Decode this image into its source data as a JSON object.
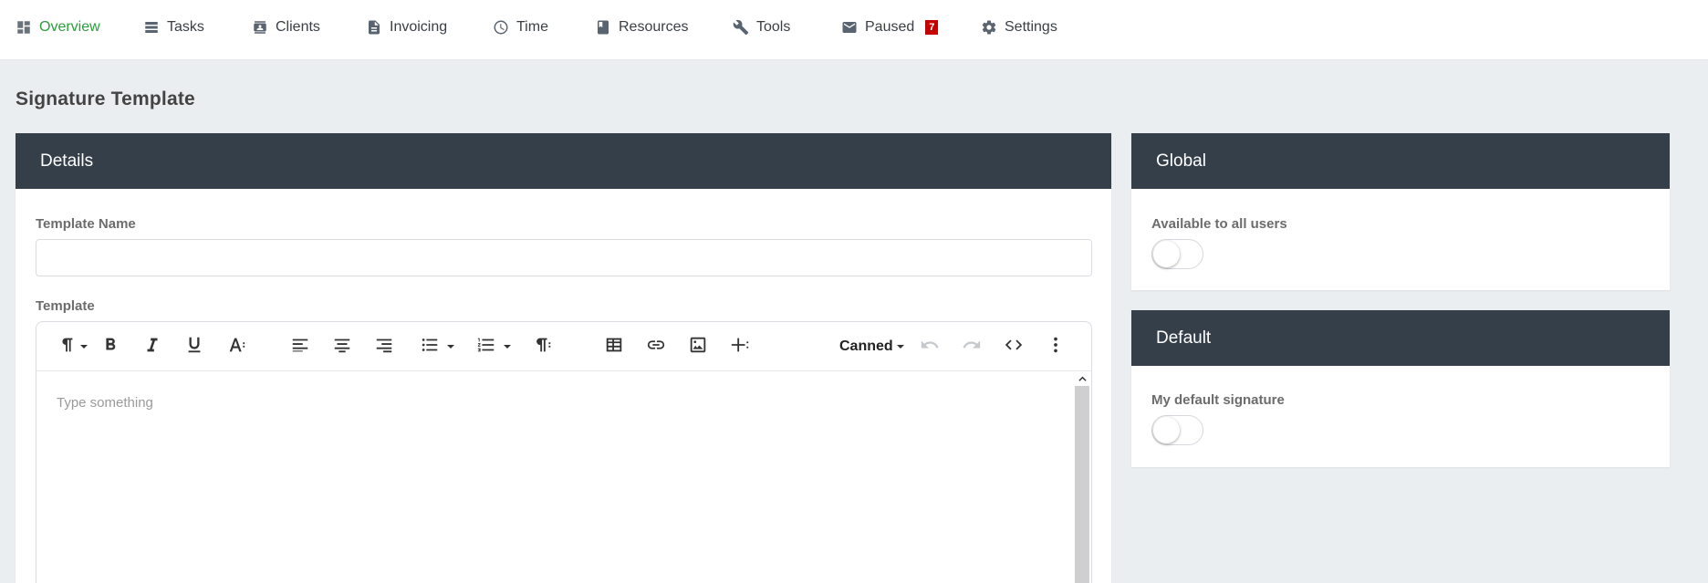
{
  "nav": {
    "items": [
      {
        "label": "Overview",
        "icon": "dashboard-icon",
        "active": true
      },
      {
        "label": "Tasks",
        "icon": "tasks-icon"
      },
      {
        "label": "Clients",
        "icon": "contact-card-icon"
      },
      {
        "label": "Invoicing",
        "icon": "document-icon"
      },
      {
        "label": "Time",
        "icon": "clock-icon"
      },
      {
        "label": "Resources",
        "icon": "book-icon"
      },
      {
        "label": "Tools",
        "icon": "wrench-icon"
      },
      {
        "label": "Paused",
        "icon": "mail-icon",
        "badge": "7"
      },
      {
        "label": "Settings",
        "icon": "gear-icon"
      }
    ],
    "active_color": "#2e9b3f",
    "badge_color": "#c40000"
  },
  "page": {
    "title": "Signature Template"
  },
  "details": {
    "header": "Details",
    "template_name_label": "Template Name",
    "template_name_value": "",
    "template_label": "Template",
    "editor": {
      "canned_label": "Canned",
      "placeholder": "Type something",
      "toolbar_icons": [
        "paragraph-format-icon",
        "bold-icon",
        "italic-icon",
        "underline-icon",
        "font-size-icon",
        "align-left-icon",
        "align-center-icon",
        "align-right-icon",
        "unordered-list-icon",
        "ordered-list-icon",
        "paragraph-style-icon",
        "table-icon",
        "link-icon",
        "image-icon",
        "insert-more-icon",
        "undo-icon",
        "redo-icon",
        "code-view-icon",
        "more-vertical-icon"
      ]
    }
  },
  "global": {
    "header": "Global",
    "toggle_label": "Available to all users",
    "toggle_on": false
  },
  "default": {
    "header": "Default",
    "toggle_label": "My default signature",
    "toggle_on": false
  },
  "colors": {
    "header_bg": "#353f4a",
    "page_bg": "#ebeef1"
  }
}
